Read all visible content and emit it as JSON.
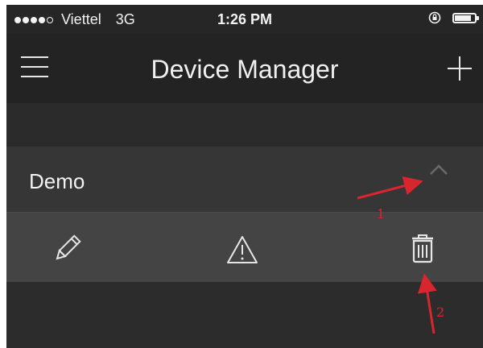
{
  "status_bar": {
    "carrier": "Viettel",
    "network": "3G",
    "time": "1:26 PM",
    "signal_bars": 4,
    "signal_total": 5,
    "battery_level": 0.85
  },
  "nav": {
    "title": "Device Manager",
    "menu_icon": "hamburger-menu-icon",
    "add_icon": "plus-icon"
  },
  "device": {
    "name": "Demo",
    "expand_icon": "chevron-up-icon"
  },
  "actions": {
    "edit_icon": "pencil-icon",
    "alert_icon": "warning-triangle-icon",
    "delete_icon": "trash-icon"
  },
  "annotations": {
    "marker_1": "1",
    "marker_2": "2",
    "arrow_color": "#d8262e"
  },
  "colors": {
    "background": "#262626",
    "nav_bg": "#232323",
    "device_row_bg": "#363636",
    "action_row_bg": "#444444",
    "text": "#f2f2f2"
  }
}
